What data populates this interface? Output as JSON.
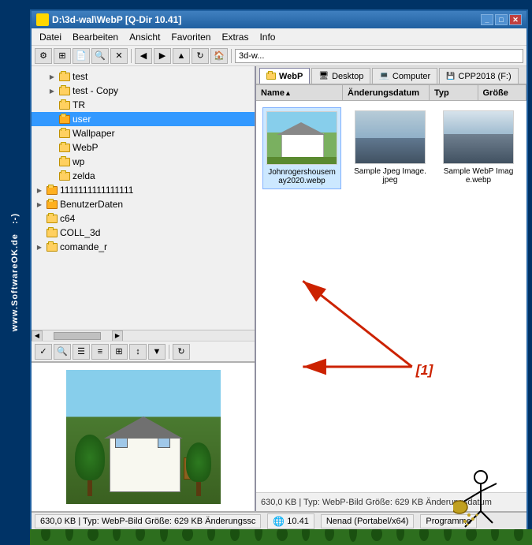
{
  "watermark": {
    "line1": "www.SoftwareOK.de",
    "smiley": ":-)"
  },
  "window": {
    "title": "D:\\3d-wal\\WebP  [Q-Dir 10.41]",
    "title_short": "3d-w..."
  },
  "menu": {
    "items": [
      "Datei",
      "Bearbeiten",
      "Ansicht",
      "Favoriten",
      "Extras",
      "Info"
    ]
  },
  "tree": {
    "items": [
      {
        "label": "test",
        "level": 1,
        "expanded": false
      },
      {
        "label": "test - Copy",
        "level": 1,
        "expanded": false
      },
      {
        "label": "TR",
        "level": 1,
        "expanded": false
      },
      {
        "label": "user",
        "level": 1,
        "expanded": false,
        "selected": true
      },
      {
        "label": "Wallpaper",
        "level": 1,
        "expanded": false
      },
      {
        "label": "WebP",
        "level": 1,
        "expanded": false
      },
      {
        "label": "wp",
        "level": 1,
        "expanded": false
      },
      {
        "label": "zelda",
        "level": 1,
        "expanded": false
      },
      {
        "label": "1111111111111111",
        "level": 0,
        "expanded": false
      },
      {
        "label": "BenutzerDaten",
        "level": 0,
        "expanded": false
      },
      {
        "label": "c64",
        "level": 0,
        "expanded": false
      },
      {
        "label": "COLL_3d",
        "level": 0,
        "expanded": false
      },
      {
        "label": "comande_r",
        "level": 0,
        "expanded": false
      }
    ]
  },
  "tabs": [
    {
      "label": "WebP",
      "active": true
    },
    {
      "label": "Desktop",
      "active": false
    },
    {
      "label": "Computer",
      "active": false
    },
    {
      "label": "CPP2018 (F:)",
      "active": false
    }
  ],
  "file_columns": [
    {
      "label": "Name",
      "sort": "asc"
    },
    {
      "label": "Änderungsdatum"
    },
    {
      "label": "Typ"
    },
    {
      "label": "Größe"
    }
  ],
  "files": [
    {
      "name": "Johnrogershousemay2020.webp",
      "type": "webp",
      "selected": true
    },
    {
      "name": "Sample Jpeg Image.jpeg",
      "type": "jpeg",
      "selected": false
    },
    {
      "name": "Sample WebP Image.webp",
      "type": "webp",
      "selected": false
    }
  ],
  "annotation": {
    "label": "[1]"
  },
  "status_right": "630,0 KB | Typ: WebP-Bild Größe: 629 KB Änderungsdatum",
  "status_main": {
    "left": "630,0 KB | Typ: WebP-Bild Größe: 629 KB Änderungssc",
    "version": "10.41",
    "user": "Nenad (Portabel/x64)",
    "right": "Programme"
  }
}
